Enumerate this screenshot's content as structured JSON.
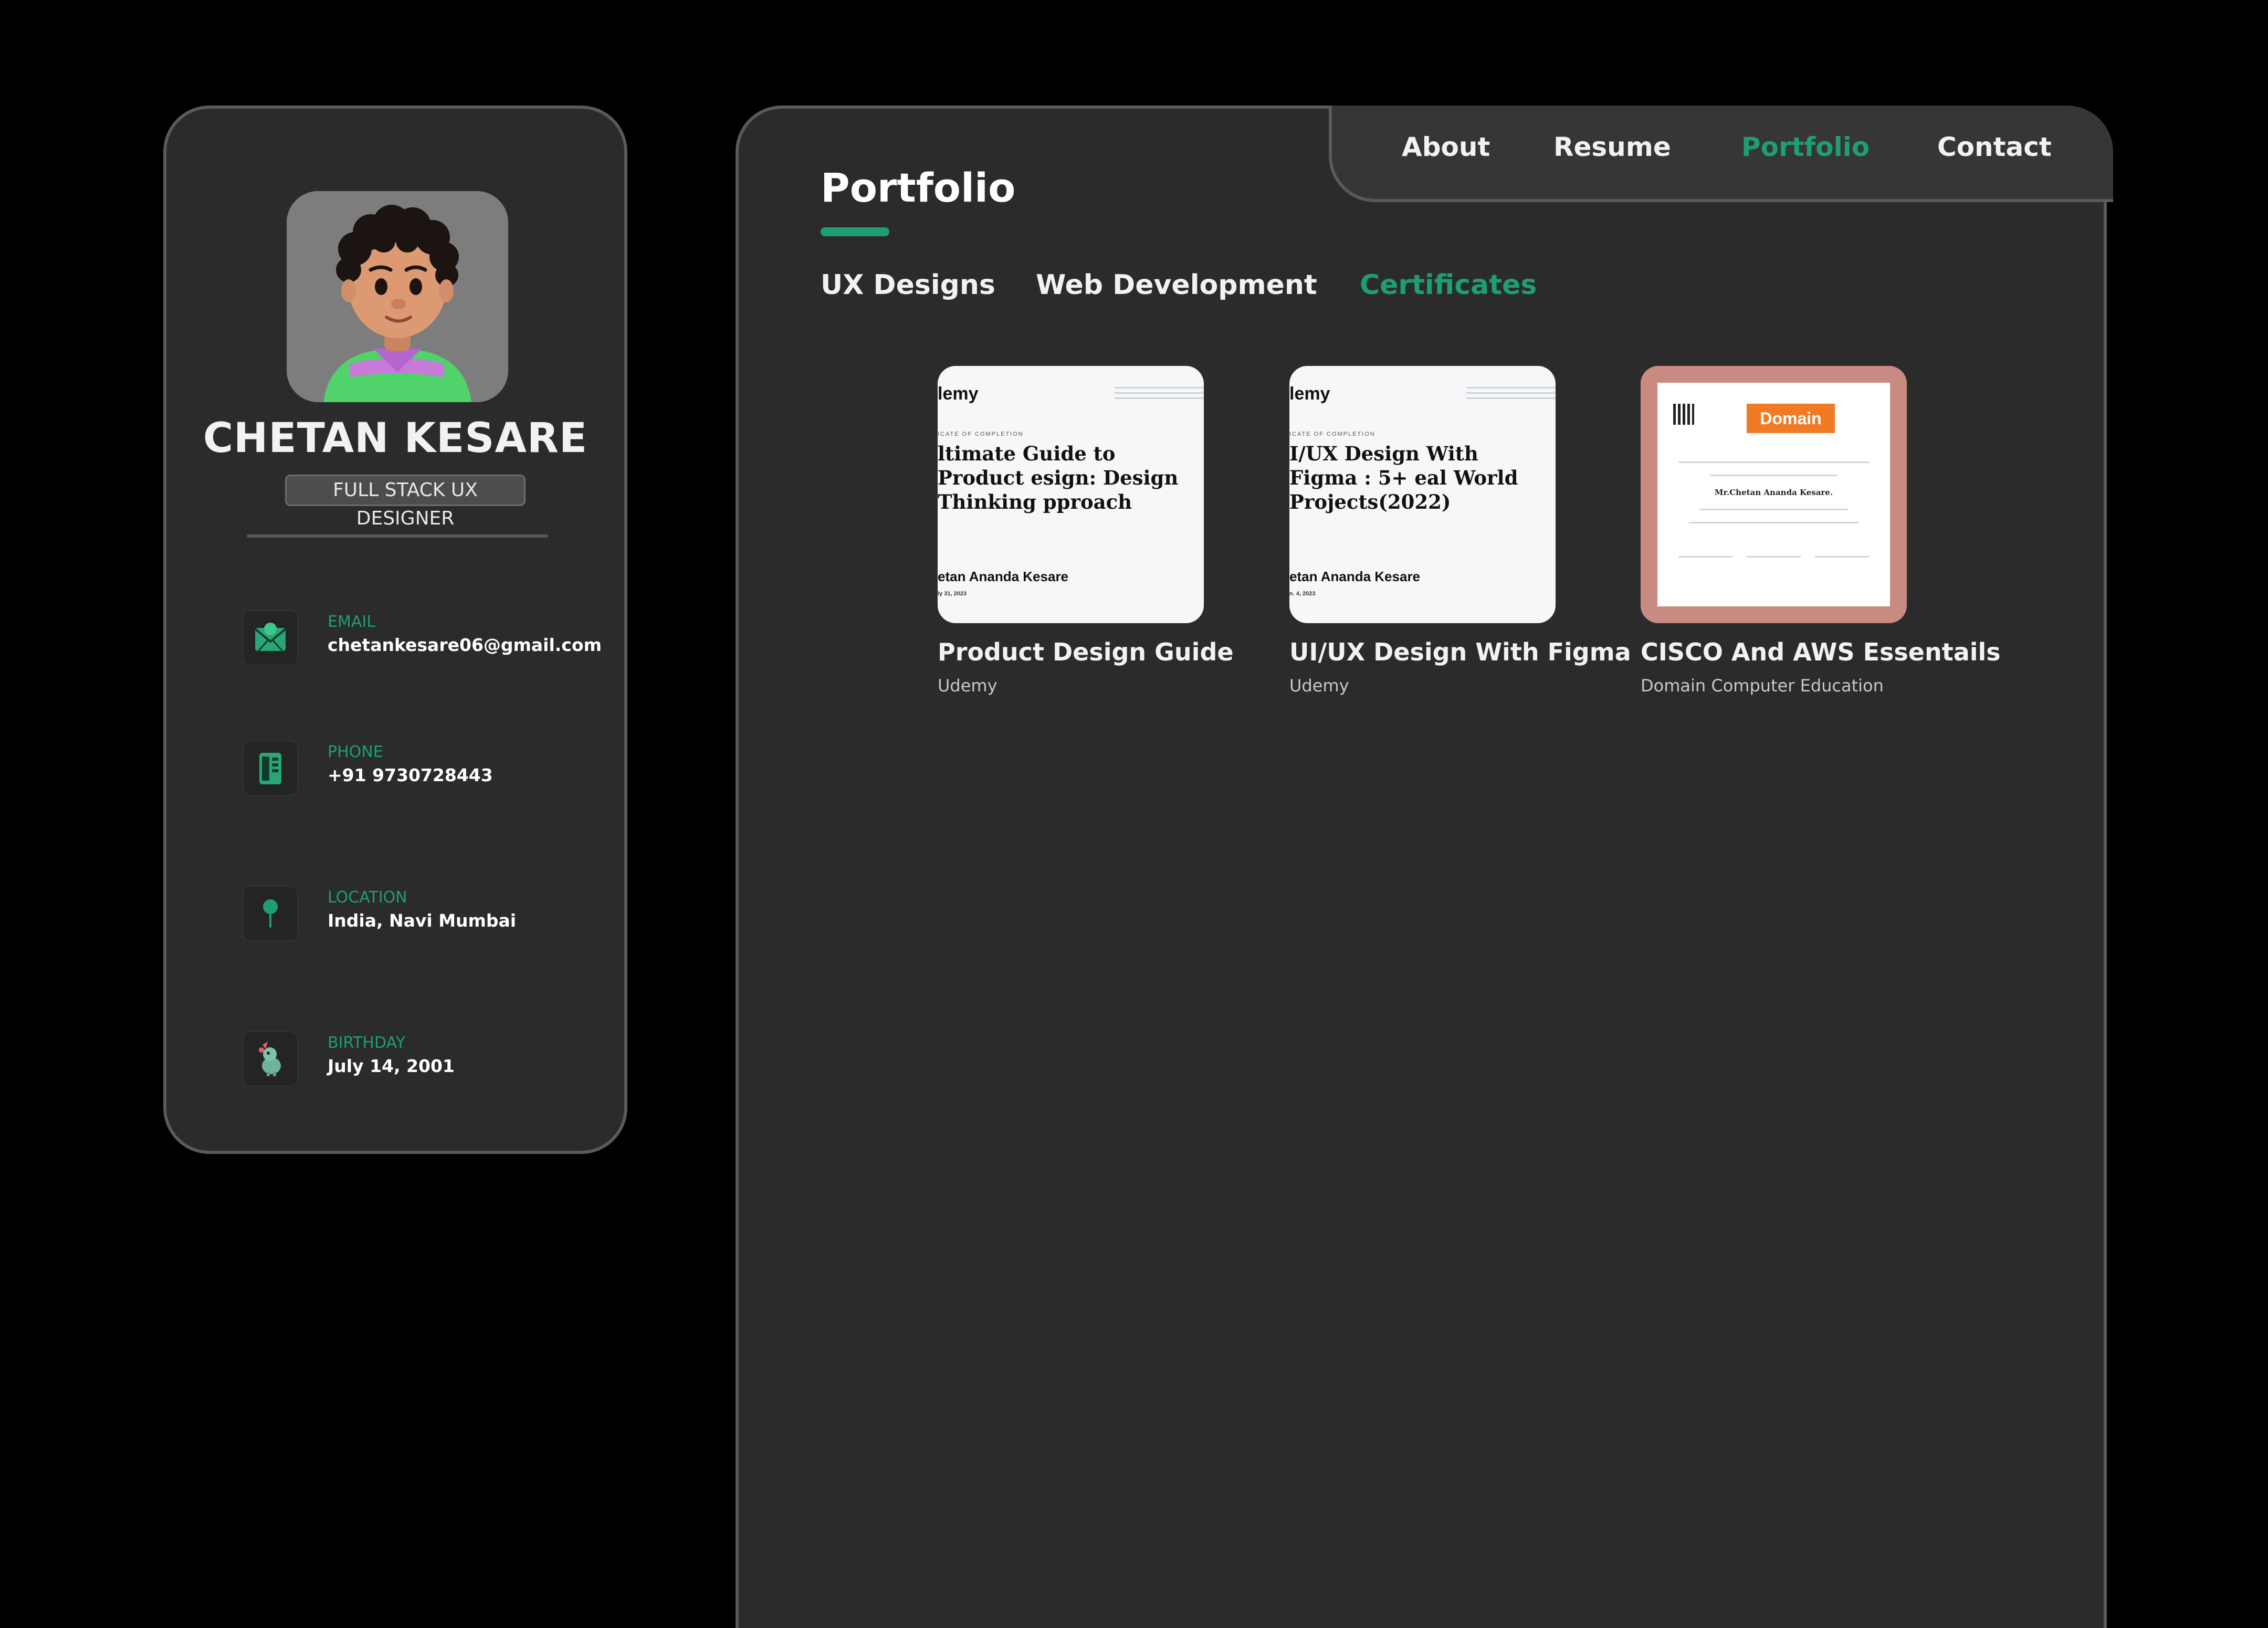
{
  "profile": {
    "name": "CHETAN KESARE",
    "role": "FULL STACK UX DESIGNER",
    "contacts": [
      {
        "label": "EMAIL",
        "value": "chetankesare06@gmail.com",
        "icon": "mail-icon"
      },
      {
        "label": "PHONE",
        "value": "+91  9730728443",
        "icon": "phone-icon"
      },
      {
        "label": "LOCATION",
        "value": "India, Navi Mumbai",
        "icon": "location-pin-icon"
      },
      {
        "label": "BIRTHDAY",
        "value": "July 14, 2001",
        "icon": "birthday-icon"
      }
    ]
  },
  "nav": {
    "items": [
      "About",
      "Resume",
      "Portfolio",
      "Contact"
    ],
    "active": "Portfolio"
  },
  "page": {
    "title": "Portfolio"
  },
  "filters": {
    "items": [
      "UX Designs",
      "Web Development",
      "Certificates"
    ],
    "active": "Certificates"
  },
  "projects": [
    {
      "title": "Product Design Guide",
      "subtitle": "Udemy",
      "thumb": {
        "brand": "lemy",
        "kind": "ICATE OF COMPLETION",
        "heading": "ltimate Guide to Product esign: Design Thinking pproach",
        "person": "etan Ananda Kesare",
        "date": "ly 31, 2023"
      }
    },
    {
      "title": "UI/UX Design With Figma",
      "subtitle": "Udemy",
      "thumb": {
        "brand": "lemy",
        "kind": "ICATE OF COMPLETION",
        "heading": "I/UX Design With Figma : 5+ eal World Projects(2022)",
        "person": "etan Ananda Kesare",
        "date": "n. 4, 2023"
      }
    },
    {
      "title": "CISCO And AWS Essentails",
      "subtitle": "Domain Computer Education",
      "thumb": {
        "brand": "Domain",
        "recipient": "Mr.Chetan Ananda Kesare."
      }
    }
  ],
  "colors": {
    "accent": "#1e9e75",
    "panel": "#2b2b2b",
    "border": "#5a5a5a",
    "background": "#000000"
  }
}
